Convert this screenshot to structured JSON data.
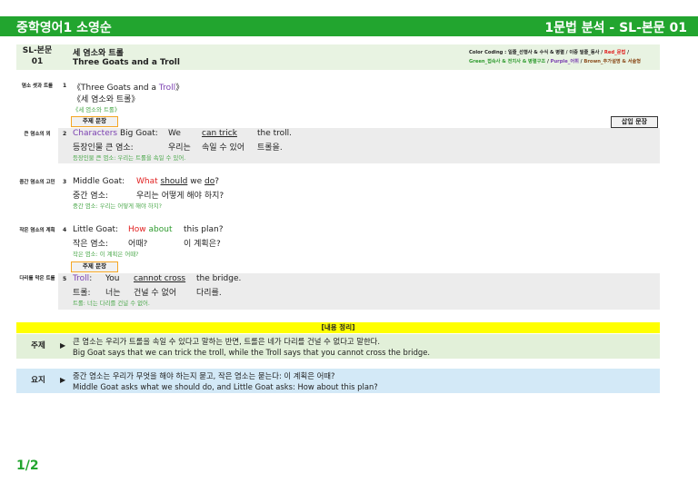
{
  "header": {
    "left_title": "중학영어1 소영순",
    "right_title": "1문법 분석 - SL-본문 01",
    "bar_color": "#22a52f"
  },
  "lesson": {
    "code": "SL-본문 01",
    "title_kr": "세 염소와 트롤",
    "title_en": "Three Goats and a Troll"
  },
  "color_coding": {
    "line1_a": "Color Coding : 일줄_선행사 & 수식 & 병렬 / 이중 밑줄_동사 / ",
    "line1_red": "Red_문법",
    "line1_end": " /",
    "line2_green": "Green_접속사 & 전치사 & 병렬구조",
    "line2_sep1": " / ",
    "line2_purple": "Purple_어휘",
    "line2_sep2": " / ",
    "line2_brown": "Brown_추가설명 & 서술형"
  },
  "badges": {
    "topic": "주제 문장",
    "insert": "삽입 문장"
  },
  "sections": {
    "s1": "염소 셋과 트롤",
    "s2": "큰 염소의 꾀",
    "s3": "중간 염소의 고민",
    "s4": "작은 염소의 계획",
    "s5": "다리를 막은 트롤"
  },
  "sentences": {
    "s1": {
      "num": "1",
      "en_a": "《Three Goats and a ",
      "en_b": "Troll",
      "en_c": "》",
      "kr": "《세 염소와 트롤》",
      "tr": "《세 염소와 트롤》"
    },
    "s2": {
      "num": "2",
      "en_characters": "Characters",
      "en_biggoat": " Big Goat:",
      "en_we": "We",
      "en_cantrick": "can trick",
      "en_thetroll": "the troll.",
      "kr_a": "등장인물 큰 염소:",
      "kr_b": "우리는",
      "kr_c": "속일 수 있어",
      "kr_d": "트롤을.",
      "tr": "등장인물 큰 염소: 우리는 트롤을 속일 수 있어."
    },
    "s3": {
      "num": "3",
      "en_a": "Middle Goat:",
      "en_what": "What",
      "en_should": "should",
      "en_we": " we ",
      "en_do": "do",
      "en_q": "?",
      "kr_a": "중간 염소:",
      "kr_b": "우리는 어떻게 해야 하지?",
      "tr": "중간 염소: 우리는 어떻게 해야 하지?"
    },
    "s4": {
      "num": "4",
      "en_a": "Little Goat:",
      "en_how": "How",
      "en_about": " about",
      "en_plan": "this plan?",
      "kr_a": "작은 염소:",
      "kr_b": "어때?",
      "kr_c": "이 계획은?",
      "tr": "작은 염소: 이 계획은 어때?"
    },
    "s5": {
      "num": "5",
      "en_troll": "Troll",
      "en_colon": ":",
      "en_you": "You",
      "en_cannot": "cannot cross",
      "en_bridge": "the bridge.",
      "kr_a": "트롤:",
      "kr_b": "너는",
      "kr_c": "건널 수 없어",
      "kr_d": "다리를.",
      "tr": "트롤: 너는 다리를 건널 수 없어."
    }
  },
  "summary": {
    "title": "[내용 정리]",
    "topic": {
      "label": "주제",
      "arrow": "▶",
      "kr": "큰 염소는 우리가 트롤을 속일 수 있다고 말하는 반면, 트롤은 네가 다리를 건널 수 없다고 말한다.",
      "en": "Big Goat says that we can trick the troll, while the Troll says that you cannot cross the bridge."
    },
    "gist": {
      "label": "요지",
      "arrow": "▶",
      "kr": "중간 염소는 우리가 무엇을 해야 하는지 묻고, 작은 염소는 묻는다: 이 계획은 어때?",
      "en": "Middle Goat asks what we should do, and Little Goat asks: How about this plan?"
    },
    "topic_bg": "#e2f0d9",
    "gist_bg": "#d3e9f7",
    "title_bg": "#ffff00"
  },
  "page": "1/2"
}
